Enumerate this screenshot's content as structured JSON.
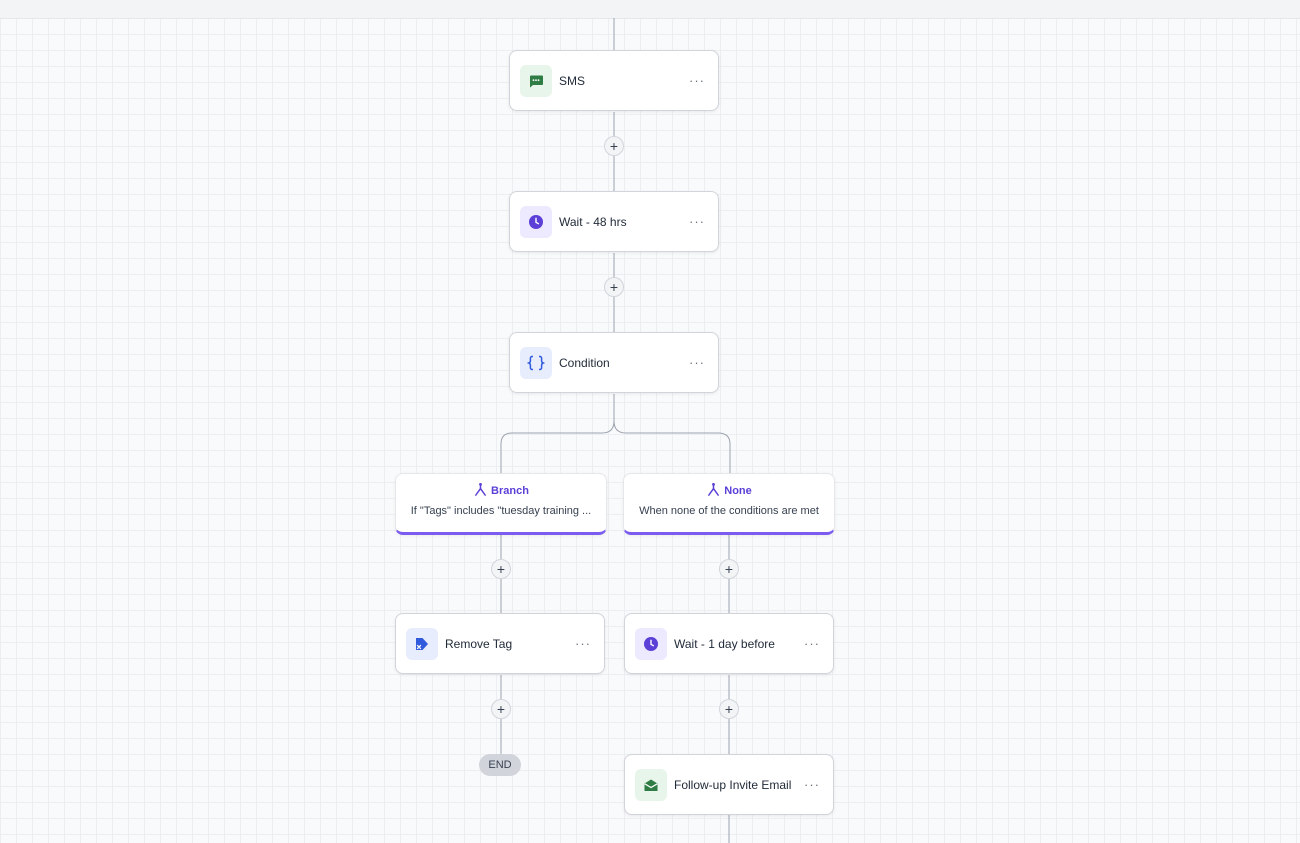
{
  "colors": {
    "accent": "#7c5cf0",
    "branch_title": "#5b3fd6",
    "sms_icon_bg": "#e7f5ea",
    "sms_icon": "#2f7d44",
    "wait_icon_bg": "#ede9fe",
    "wait_icon": "#5b3fd6",
    "condition_icon_bg": "#e8edfd",
    "condition_icon": "#2f5bdc",
    "tag_icon_bg": "#e8edfd",
    "tag_icon": "#2f5bdc",
    "email_icon_bg": "#e7f5ea",
    "email_icon": "#2f7d44"
  },
  "workflow": {
    "nodes": [
      {
        "id": "sms",
        "label": "SMS",
        "icon": "sms-icon",
        "more": "···"
      },
      {
        "id": "wait-48",
        "label": "Wait - 48 hrs",
        "icon": "clock-icon",
        "more": "···"
      },
      {
        "id": "condition",
        "label": "Condition",
        "icon": "braces-icon",
        "more": "···"
      },
      {
        "id": "remove-tag",
        "label": "Remove Tag",
        "icon": "tag-remove-icon",
        "more": "···"
      },
      {
        "id": "wait-1day",
        "label": "Wait - 1 day before",
        "icon": "clock-icon",
        "more": "···"
      },
      {
        "id": "followup-email",
        "label": "Follow-up Invite Email",
        "icon": "email-icon",
        "more": "···"
      }
    ],
    "branches": [
      {
        "title": "Branch",
        "description": "If \"Tags\" includes \"tuesday training ...",
        "icon": "branch-icon"
      },
      {
        "title": "None",
        "description": "When none of the conditions are met",
        "icon": "branch-icon"
      }
    ],
    "add_step_label": "+",
    "end_label": "END"
  }
}
